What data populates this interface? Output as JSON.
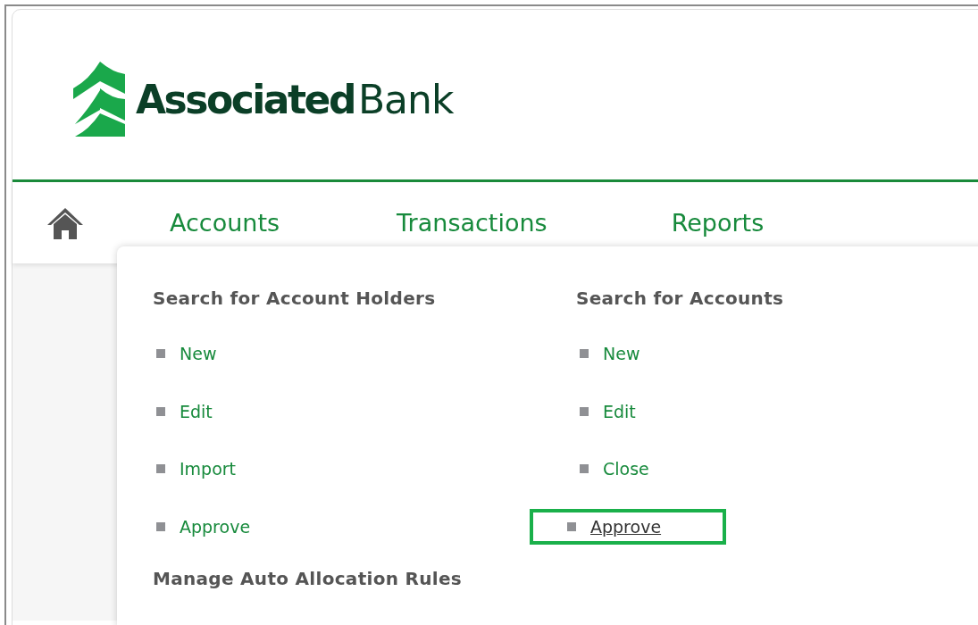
{
  "logo": {
    "name_bold": "Associated",
    "name_regular": "Bank"
  },
  "nav": {
    "items": [
      {
        "label": "Accounts"
      },
      {
        "label": "Transactions"
      },
      {
        "label": "Reports"
      }
    ]
  },
  "dropdown": {
    "columns": [
      {
        "heading": "Search for Account Holders",
        "items": [
          {
            "label": "New",
            "selected": false
          },
          {
            "label": "Edit",
            "selected": false
          },
          {
            "label": "Import",
            "selected": false
          },
          {
            "label": "Approve",
            "selected": false
          }
        ]
      },
      {
        "heading": "Search for Accounts",
        "items": [
          {
            "label": "New",
            "selected": false
          },
          {
            "label": "Edit",
            "selected": false
          },
          {
            "label": "Close",
            "selected": false
          },
          {
            "label": "Approve",
            "selected": true
          }
        ]
      }
    ],
    "footer_heading": "Manage Auto Allocation Rules"
  }
}
